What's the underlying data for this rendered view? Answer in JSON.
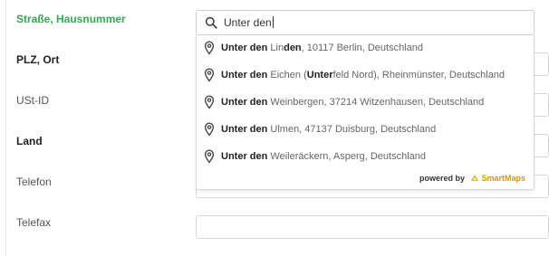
{
  "form": {
    "labels": {
      "street": "Straße, Hausnummer",
      "postal_city": "PLZ, Ort",
      "vat_id": "USt-ID",
      "country": "Land",
      "phone": "Telefon",
      "fax": "Telefax"
    },
    "street_input": {
      "value": "Unter den"
    },
    "colors": {
      "active_label": "#34a853"
    }
  },
  "autocomplete": {
    "suggestions": [
      {
        "bold": "Unter den",
        "mid": " Lin",
        "bold2": "den",
        "rest": ", 10117 Berlin, Deutschland"
      },
      {
        "bold": "Unter den",
        "mid": " Eichen (",
        "bold2": "Unter",
        "rest": "feld Nord), Rheinmünster, Deutschland"
      },
      {
        "bold": "Unter den",
        "mid": " Weinbergen, 37214 Witzenhausen, Deutschland",
        "bold2": "",
        "rest": ""
      },
      {
        "bold": "Unter den",
        "mid": " Ulmen, 47137 Duisburg, Deutschland",
        "bold2": "",
        "rest": ""
      },
      {
        "bold": "Unter den",
        "mid": " Weileräckern, Asperg, Deutschland",
        "bold2": "",
        "rest": ""
      }
    ],
    "powered_by": {
      "prefix": "powered by",
      "brand": "SmartMaps"
    },
    "icons": {
      "search": "search-icon",
      "pin": "map-pin-icon",
      "logo": "smartmaps-logo-icon"
    }
  }
}
